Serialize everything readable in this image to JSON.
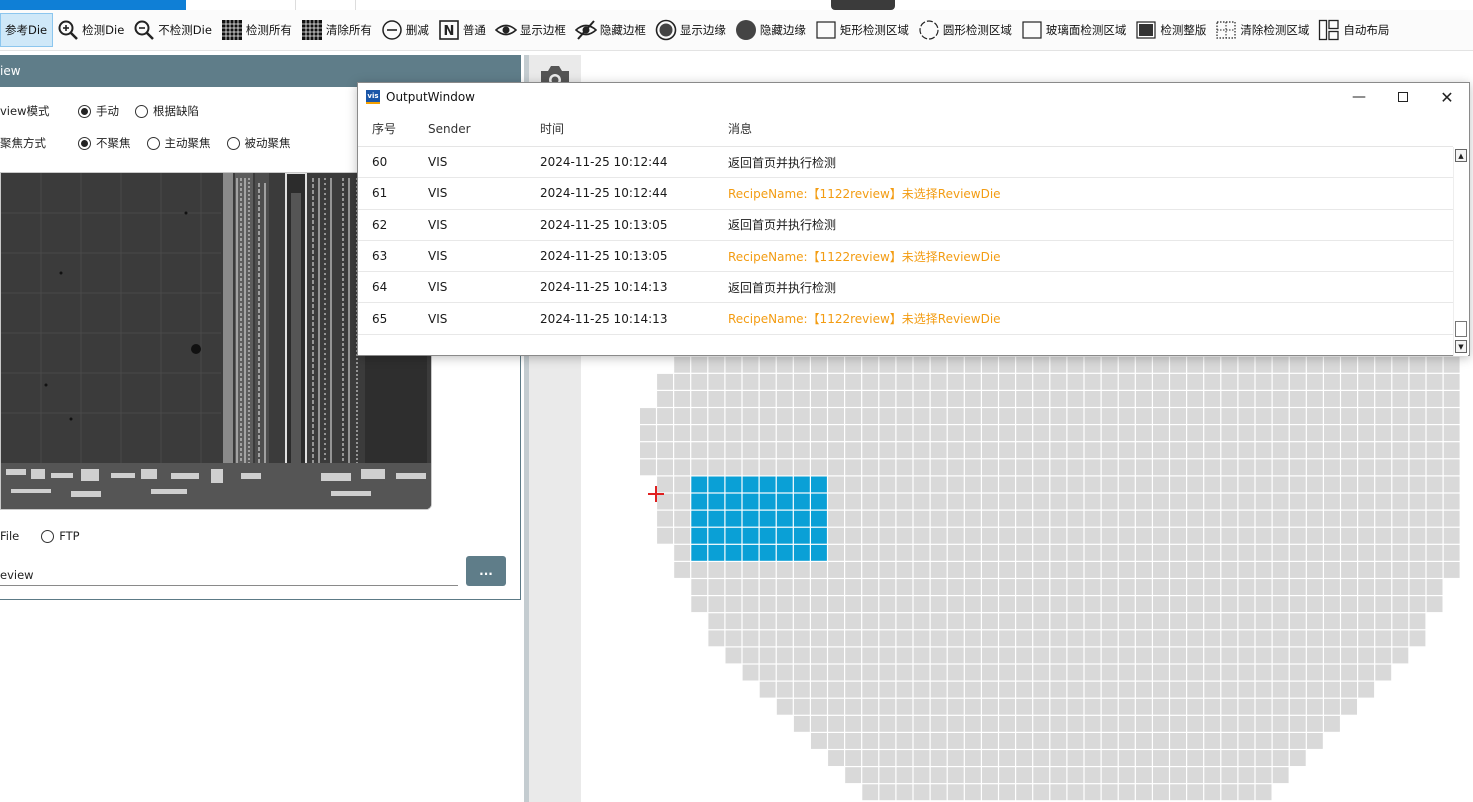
{
  "toolbar": {
    "items": [
      {
        "label": "参考Die",
        "icon": "reference-die-icon"
      },
      {
        "label": "检测Die",
        "icon": "zoom-in-icon"
      },
      {
        "label": "不检测Die",
        "icon": "zoom-out-icon"
      },
      {
        "label": "检测所有",
        "icon": "grid-all-icon"
      },
      {
        "label": "清除所有",
        "icon": "grid-clear-icon"
      },
      {
        "label": "删减",
        "icon": "minus-circle-icon"
      },
      {
        "label": "普通",
        "icon": "normal-n-icon"
      },
      {
        "label": "显示边框",
        "icon": "eye-icon"
      },
      {
        "label": "隐藏边框",
        "icon": "eye-off-icon"
      },
      {
        "label": "显示边缘",
        "icon": "circle-outline-icon"
      },
      {
        "label": "隐藏边缘",
        "icon": "circle-filled-icon"
      },
      {
        "label": "矩形检测区域",
        "icon": "rectangle-icon"
      },
      {
        "label": "圆形检测区域",
        "icon": "circle-dashed-icon"
      },
      {
        "label": "玻璃面检测区域",
        "icon": "glass-rect-icon"
      },
      {
        "label": "检测整版",
        "icon": "full-board-icon"
      },
      {
        "label": "清除检测区域",
        "icon": "dotted-rect-icon"
      },
      {
        "label": "自动布局",
        "icon": "auto-layout-icon"
      }
    ]
  },
  "left_panel": {
    "header": "iew",
    "review_mode_label": "view模式",
    "review_mode_options": [
      "手动",
      "根据缺陷"
    ],
    "review_mode_selected": 0,
    "focus_label": "聚焦方式",
    "focus_options": [
      "不聚焦",
      "主动聚焦",
      "被动聚焦"
    ],
    "focus_selected": 0,
    "source_options": [
      "File",
      "FTP"
    ],
    "path_value": "eview",
    "browse_label": "..."
  },
  "output_window": {
    "title": "OutputWindow",
    "columns": [
      "序号",
      "Sender",
      "时间",
      "消息"
    ],
    "rows": [
      {
        "id": "60",
        "sender": "VIS",
        "time": "2024-11-25 10:12:44",
        "message": "返回首页并执行检测",
        "warn": false
      },
      {
        "id": "61",
        "sender": "VIS",
        "time": "2024-11-25 10:12:44",
        "message": "RecipeName:【1122review】未选择ReviewDie",
        "warn": true
      },
      {
        "id": "62",
        "sender": "VIS",
        "time": "2024-11-25 10:13:05",
        "message": "返回首页并执行检测",
        "warn": false
      },
      {
        "id": "63",
        "sender": "VIS",
        "time": "2024-11-25 10:13:05",
        "message": "RecipeName:【1122review】未选择ReviewDie",
        "warn": true
      },
      {
        "id": "64",
        "sender": "VIS",
        "time": "2024-11-25 10:14:13",
        "message": "返回首页并执行检测",
        "warn": false
      },
      {
        "id": "65",
        "sender": "VIS",
        "time": "2024-11-25 10:14:13",
        "message": "RecipeName:【1122review】未选择ReviewDie",
        "warn": true
      }
    ]
  },
  "colors": {
    "accent": "#0f7fd6",
    "panel_header": "#5f7d89",
    "warn_text": "#f39c12",
    "die_selected": "#0aa0d6",
    "die_default": "#d9d9d9",
    "marker": "#e02020"
  }
}
